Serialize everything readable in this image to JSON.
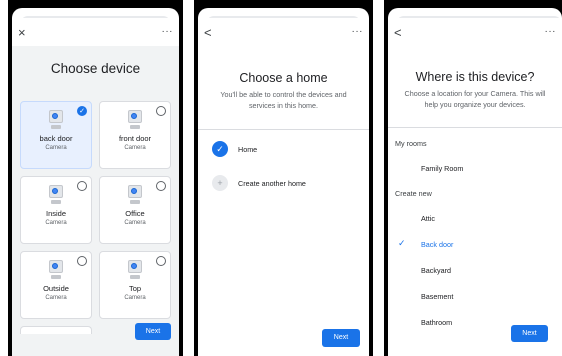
{
  "colors": {
    "accent": "#1a73e8",
    "selected_card": "#e8f0fe",
    "panel_bg": "#f1f3f4"
  },
  "screen1": {
    "close_icon": "×",
    "more_icon": "···",
    "title": "Choose device",
    "devices": [
      {
        "name": "back door",
        "type": "Camera",
        "selected": true
      },
      {
        "name": "front door",
        "type": "Camera",
        "selected": false
      },
      {
        "name": "Inside",
        "type": "Camera",
        "selected": false
      },
      {
        "name": "Office",
        "type": "Camera",
        "selected": false
      },
      {
        "name": "Outside",
        "type": "Camera",
        "selected": false
      },
      {
        "name": "Top",
        "type": "Camera",
        "selected": false
      }
    ],
    "next_label": "Next"
  },
  "screen2": {
    "back_icon": "<",
    "more_icon": "···",
    "title": "Choose a home",
    "subtitle": "You'll be able to control the devices and services in this home.",
    "options": [
      {
        "label": "Home",
        "selected": true,
        "icon": "✓"
      },
      {
        "label": "Create another home",
        "selected": false,
        "icon": "+"
      }
    ],
    "next_label": "Next"
  },
  "screen3": {
    "back_icon": "<",
    "more_icon": "···",
    "title": "Where is this device?",
    "subtitle": "Choose a location for your Camera. This will help you organize your devices.",
    "my_rooms_label": "My rooms",
    "my_rooms": [
      "Family Room"
    ],
    "create_new_label": "Create new",
    "create_new": [
      "Attic",
      "Back door",
      "Backyard",
      "Basement",
      "Bathroom"
    ],
    "selected_room": "Back door",
    "check_icon": "✓",
    "next_label": "Next"
  }
}
